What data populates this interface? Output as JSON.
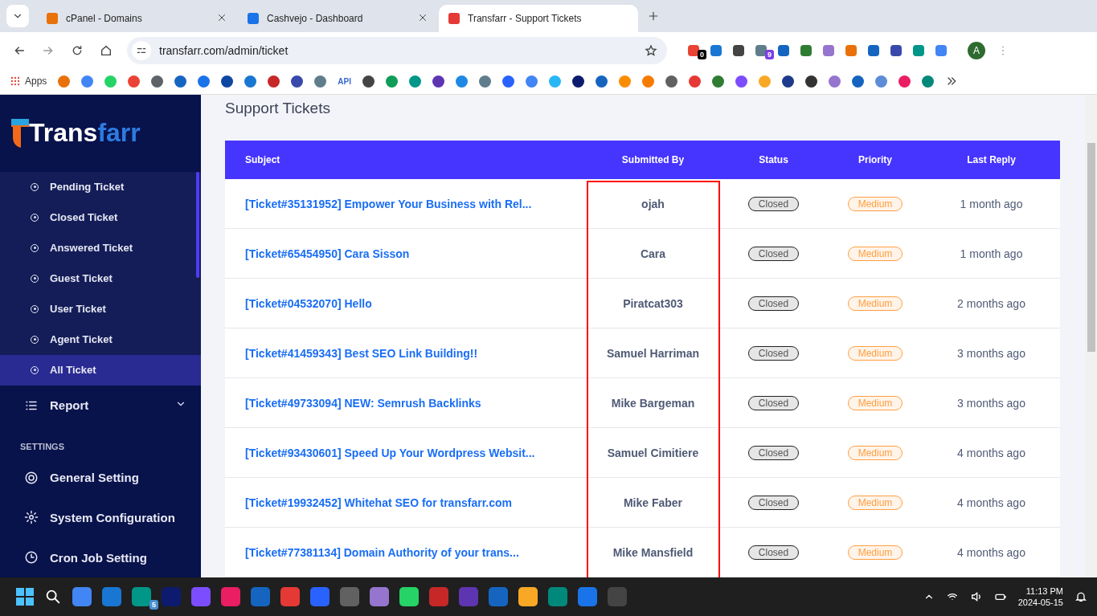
{
  "browser": {
    "tabs": [
      {
        "title": "cPanel - Domains",
        "selected": false
      },
      {
        "title": "Cashvejo - Dashboard",
        "selected": false
      },
      {
        "title": "Transfarr - Support Tickets",
        "selected": true
      }
    ],
    "address": "transfarr.com/admin/ticket",
    "extensions": [
      {
        "kind": "badged",
        "badge": "0"
      },
      {
        "kind": "icon"
      },
      {
        "kind": "icon"
      },
      {
        "kind": "badged",
        "badge": "9"
      },
      {
        "kind": "icon"
      },
      {
        "kind": "icon"
      },
      {
        "kind": "icon"
      },
      {
        "kind": "icon"
      },
      {
        "kind": "icon"
      },
      {
        "kind": "icon"
      },
      {
        "kind": "icon"
      },
      {
        "kind": "icon"
      }
    ],
    "profile": "A",
    "bookmarks": {
      "apps_label": "Apps",
      "items": [
        {
          "kind": "icon"
        },
        {
          "kind": "icon"
        },
        {
          "kind": "icon"
        },
        {
          "kind": "icon"
        },
        {
          "kind": "icon"
        },
        {
          "kind": "icon"
        },
        {
          "kind": "icon"
        },
        {
          "kind": "icon"
        },
        {
          "kind": "icon"
        },
        {
          "kind": "icon"
        },
        {
          "kind": "icon"
        },
        {
          "kind": "icon"
        },
        {
          "kind": "text",
          "label": "API"
        },
        {
          "kind": "icon"
        },
        {
          "kind": "icon"
        },
        {
          "kind": "icon"
        },
        {
          "kind": "icon"
        },
        {
          "kind": "icon"
        },
        {
          "kind": "icon"
        },
        {
          "kind": "icon"
        },
        {
          "kind": "icon"
        },
        {
          "kind": "icon"
        },
        {
          "kind": "icon"
        },
        {
          "kind": "icon"
        },
        {
          "kind": "icon"
        },
        {
          "kind": "icon"
        },
        {
          "kind": "icon"
        },
        {
          "kind": "icon"
        },
        {
          "kind": "icon"
        },
        {
          "kind": "icon"
        },
        {
          "kind": "icon"
        },
        {
          "kind": "icon"
        },
        {
          "kind": "icon"
        },
        {
          "kind": "icon"
        },
        {
          "kind": "icon"
        },
        {
          "kind": "icon"
        },
        {
          "kind": "icon"
        },
        {
          "kind": "icon"
        }
      ]
    }
  },
  "sidebar": {
    "logo": {
      "part_1": "Trans",
      "part_2": "farr"
    },
    "ticket_items": [
      {
        "label": "Pending Ticket",
        "selected": false
      },
      {
        "label": "Closed Ticket",
        "selected": false
      },
      {
        "label": "Answered Ticket",
        "selected": false
      },
      {
        "label": "Guest Ticket",
        "selected": false
      },
      {
        "label": "User Ticket",
        "selected": false
      },
      {
        "label": "Agent Ticket",
        "selected": false
      },
      {
        "label": "All Ticket",
        "selected": true
      }
    ],
    "report": {
      "label": "Report",
      "expanded": false
    },
    "section": "SETTINGS",
    "settings_items": [
      {
        "label": "General Setting",
        "kind": "lifebuoy"
      },
      {
        "label": "System Configuration",
        "kind": "gear"
      },
      {
        "label": "Cron Job Setting",
        "kind": "clock"
      }
    ]
  },
  "page": {
    "title": "Support Tickets",
    "table": {
      "columns": [
        "Subject",
        "Submitted By",
        "Status",
        "Priority",
        "Last Reply"
      ],
      "rows": [
        {
          "subject": "[Ticket#35131952] Empower Your Business with Rel...",
          "submitted_by": "ojah",
          "status": "Closed",
          "priority": "Medium",
          "last_reply": "1 month ago"
        },
        {
          "subject": "[Ticket#65454950] Cara Sisson",
          "submitted_by": "Cara",
          "status": "Closed",
          "priority": "Medium",
          "last_reply": "1 month ago"
        },
        {
          "subject": "[Ticket#04532070] Hello",
          "submitted_by": "Piratcat303",
          "status": "Closed",
          "priority": "Medium",
          "last_reply": "2 months ago"
        },
        {
          "subject": "[Ticket#41459343] Best SEO Link Building!!",
          "submitted_by": "Samuel Harriman",
          "status": "Closed",
          "priority": "Medium",
          "last_reply": "3 months ago"
        },
        {
          "subject": "[Ticket#49733094] NEW: Semrush Backlinks",
          "submitted_by": "Mike Bargeman",
          "status": "Closed",
          "priority": "Medium",
          "last_reply": "3 months ago"
        },
        {
          "subject": "[Ticket#93430601] Speed Up Your Wordpress Websit...",
          "submitted_by": "Samuel Cimitiere",
          "status": "Closed",
          "priority": "Medium",
          "last_reply": "4 months ago"
        },
        {
          "subject": "[Ticket#19932452] Whitehat SEO for transfarr.com",
          "submitted_by": "Mike Faber",
          "status": "Closed",
          "priority": "Medium",
          "last_reply": "4 months ago"
        },
        {
          "subject": "[Ticket#77381134] Domain Authority of your trans...",
          "submitted_by": "Mike Mansfield",
          "status": "Closed",
          "priority": "Medium",
          "last_reply": "4 months ago"
        }
      ]
    }
  },
  "taskbar": {
    "apps": [
      {
        "kind": "icon"
      },
      {
        "kind": "icon"
      },
      {
        "kind": "badged",
        "badge": "5"
      },
      {
        "kind": "icon"
      },
      {
        "kind": "icon"
      },
      {
        "kind": "icon"
      },
      {
        "kind": "icon"
      },
      {
        "kind": "icon"
      },
      {
        "kind": "icon"
      },
      {
        "kind": "icon"
      },
      {
        "kind": "icon"
      },
      {
        "kind": "icon"
      },
      {
        "kind": "icon"
      },
      {
        "kind": "icon"
      },
      {
        "kind": "icon"
      },
      {
        "kind": "icon"
      },
      {
        "kind": "icon"
      },
      {
        "kind": "icon"
      },
      {
        "kind": "icon"
      }
    ],
    "time": "11:13 PM",
    "date": "2024-05-15"
  }
}
